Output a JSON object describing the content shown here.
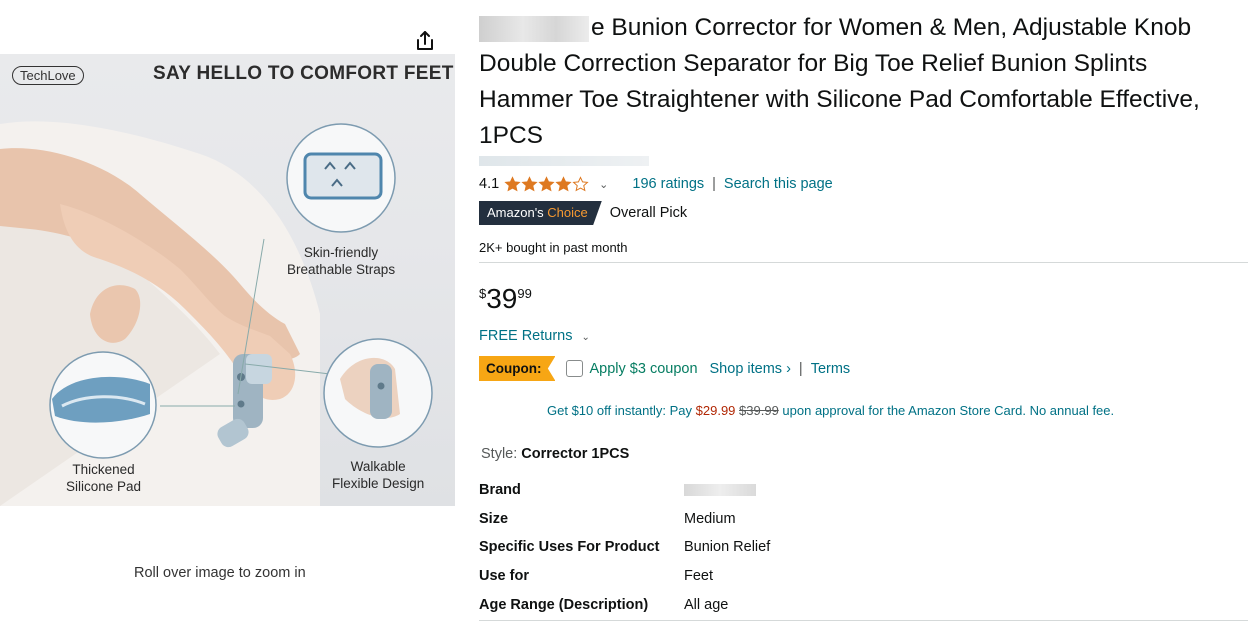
{
  "image_panel": {
    "logo": "TechLove",
    "headline": "SAY HELLO TO COMFORT FEET",
    "callouts": {
      "straps": [
        "Skin-friendly",
        "Breathable Straps"
      ],
      "pad": [
        "Thickened",
        "Silicone Pad"
      ],
      "design": [
        "Walkable",
        "Flexible Design"
      ]
    },
    "zoom_hint": "Roll over image to zoom in"
  },
  "product": {
    "title": "e Bunion Corrector for Women & Men, Adjustable Knob Double Correction Separator for Big Toe Relief Bunion Splints Hammer Toe Straightener with Silicone Pad Comfortable Effective, 1PCS",
    "rating": "4.1",
    "rating_stars": 4.1,
    "ratings_count": "196 ratings",
    "search_page": "Search this page",
    "choice_badge": {
      "prefix": "Amazon's",
      "highlight": "Choice"
    },
    "choice_label": "Overall Pick",
    "bought": "2K+ bought in past month",
    "price": {
      "symbol": "$",
      "whole": "39",
      "fraction": "99"
    },
    "returns": "FREE Returns",
    "coupon": {
      "badge": "Coupon:",
      "text": "Apply $3 coupon",
      "shop": "Shop items",
      "terms": "Terms"
    },
    "card_offer": {
      "lead": "Get $10 off instantly: Pay",
      "price": "$29.99",
      "old": "$39.99",
      "tail": "upon approval for the Amazon Store Card. No annual fee."
    },
    "style": {
      "label": "Style:",
      "value": "Corrector 1PCS"
    },
    "specs": [
      {
        "key": "Brand",
        "value": ""
      },
      {
        "key": "Size",
        "value": "Medium"
      },
      {
        "key": "Specific Uses For Product",
        "value": "Bunion Relief"
      },
      {
        "key": "Use for",
        "value": "Feet"
      },
      {
        "key": "Age Range (Description)",
        "value": "All age"
      }
    ]
  },
  "colors": {
    "link": "#007185",
    "star": "#DE7921",
    "badge_dark": "#232F3E",
    "choice_orange": "#F69931",
    "coupon": "#F7A614",
    "price_red": "#B12704",
    "coupon_green": "#067D62"
  },
  "icons": [
    "share-icon",
    "star-icon",
    "chevron-down-icon",
    "checkbox-icon"
  ]
}
